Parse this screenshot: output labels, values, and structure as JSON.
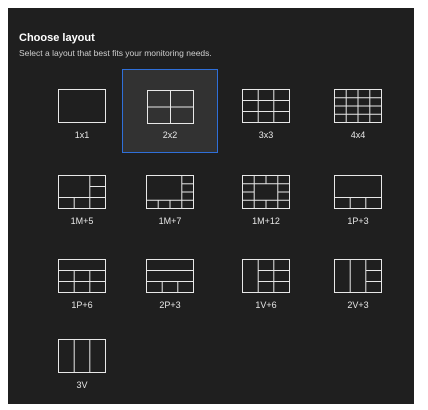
{
  "header": {
    "title": "Choose layout",
    "subtitle": "Select a layout that best fits your monitoring needs."
  },
  "layouts": [
    {
      "label": "1x1",
      "selected": false,
      "icon": "layout-1x1-icon"
    },
    {
      "label": "2x2",
      "selected": true,
      "icon": "layout-2x2-icon"
    },
    {
      "label": "3x3",
      "selected": false,
      "icon": "layout-3x3-icon"
    },
    {
      "label": "4x4",
      "selected": false,
      "icon": "layout-4x4-icon"
    },
    {
      "label": "1M+5",
      "selected": false,
      "icon": "layout-1m5-icon"
    },
    {
      "label": "1M+7",
      "selected": false,
      "icon": "layout-1m7-icon"
    },
    {
      "label": "1M+12",
      "selected": false,
      "icon": "layout-1m12-icon"
    },
    {
      "label": "1P+3",
      "selected": false,
      "icon": "layout-1p3-icon"
    },
    {
      "label": "1P+6",
      "selected": false,
      "icon": "layout-1p6-icon"
    },
    {
      "label": "2P+3",
      "selected": false,
      "icon": "layout-2p3-icon"
    },
    {
      "label": "1V+6",
      "selected": false,
      "icon": "layout-1v6-icon"
    },
    {
      "label": "2V+3",
      "selected": false,
      "icon": "layout-2v3-icon"
    },
    {
      "label": "3V",
      "selected": false,
      "icon": "layout-3v-icon"
    }
  ],
  "colors": {
    "panel_background": "#1f1f1f",
    "selected_background": "#323232",
    "selected_border": "#2f6fd8",
    "icon_stroke": "#e8e8e8"
  }
}
